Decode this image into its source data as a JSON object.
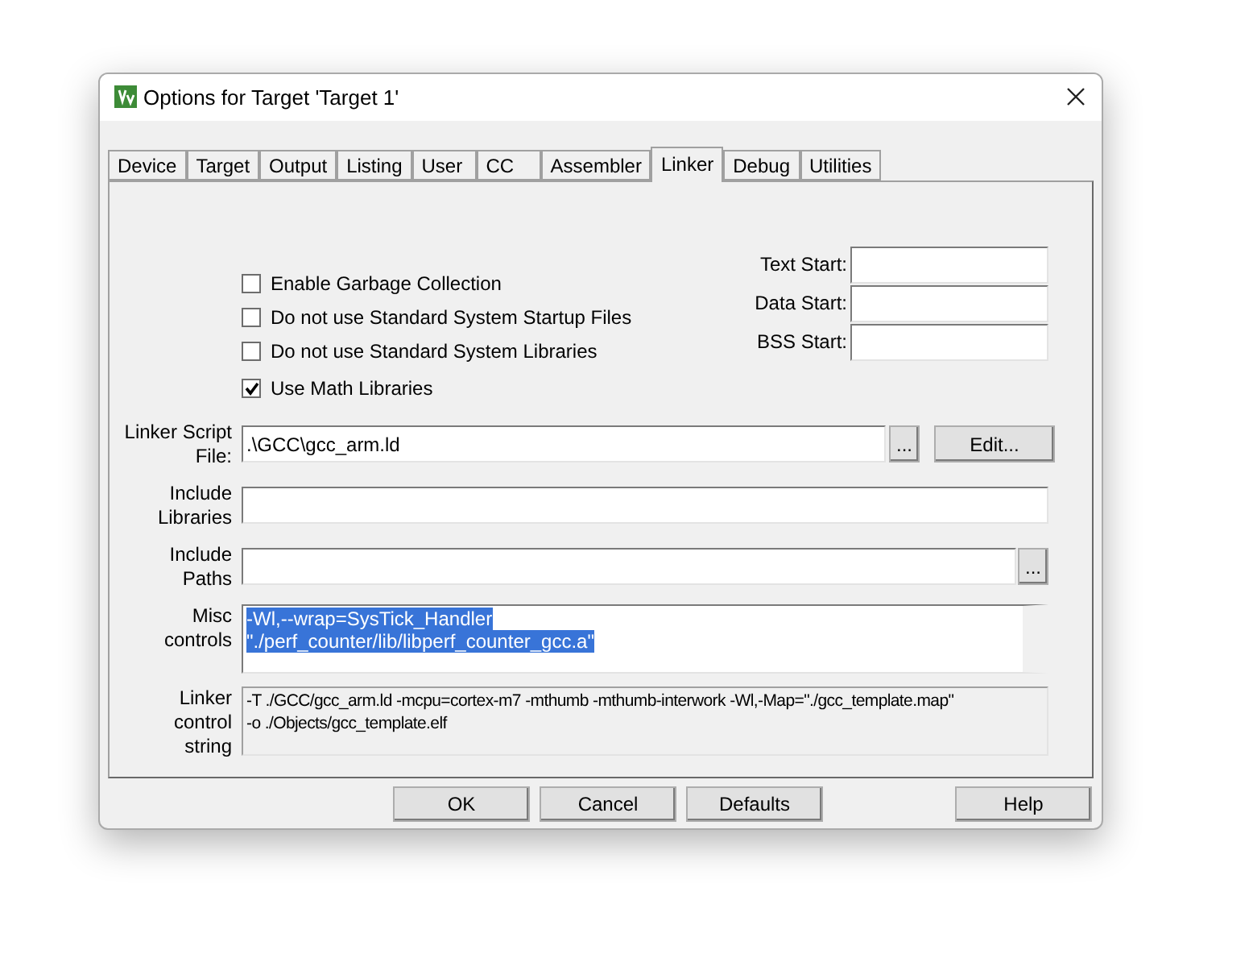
{
  "window": {
    "title": "Options for Target 'Target 1'"
  },
  "tabs": [
    {
      "label": "Device",
      "selected": false
    },
    {
      "label": "Target",
      "selected": false
    },
    {
      "label": "Output",
      "selected": false
    },
    {
      "label": "Listing",
      "selected": false
    },
    {
      "label": "User",
      "selected": false
    },
    {
      "label": "CC",
      "selected": false
    },
    {
      "label": "Assembler",
      "selected": false
    },
    {
      "label": "Linker",
      "selected": true
    },
    {
      "label": "Debug",
      "selected": false
    },
    {
      "label": "Utilities",
      "selected": false
    }
  ],
  "options": [
    {
      "label": "Enable Garbage Collection",
      "checked": false
    },
    {
      "label": "Do not use Standard System Startup Files",
      "checked": false
    },
    {
      "label": "Do not use Standard System Libraries",
      "checked": false
    },
    {
      "label": "Use Math Libraries",
      "checked": true
    }
  ],
  "address_fields": [
    {
      "label": "Text Start:"
    },
    {
      "label": "Data Start:"
    },
    {
      "label": "BSS Start:"
    }
  ],
  "linker_script": {
    "label_lines": [
      "Linker Script",
      "File:"
    ],
    "value": ".\\GCC\\gcc_arm.ld",
    "browse": "...",
    "edit": "Edit..."
  },
  "include_libraries": {
    "label_lines": [
      "Include",
      "Libraries"
    ]
  },
  "include_paths": {
    "label_lines": [
      "Include",
      "Paths"
    ],
    "browse": "..."
  },
  "misc_controls": {
    "label_lines": [
      "Misc",
      "controls"
    ],
    "lines": [
      "-Wl,--wrap=SysTick_Handler",
      "\"./perf_counter/lib/libperf_counter_gcc.a\""
    ],
    "selected": true
  },
  "control_string": {
    "label_lines": [
      "Linker",
      "control",
      "string"
    ],
    "lines": [
      "-T ./GCC/gcc_arm.ld -mcpu=cortex-m7 -mthumb -mthumb-interwork -Wl,-Map=\"./gcc_template.map\"",
      "-o ./Objects/gcc_template.elf"
    ]
  },
  "buttons": [
    {
      "label": "OK",
      "kind": "left"
    },
    {
      "label": "Cancel",
      "kind": "left"
    },
    {
      "label": "Defaults",
      "kind": "left"
    },
    {
      "label": "Help",
      "kind": "right"
    }
  ]
}
